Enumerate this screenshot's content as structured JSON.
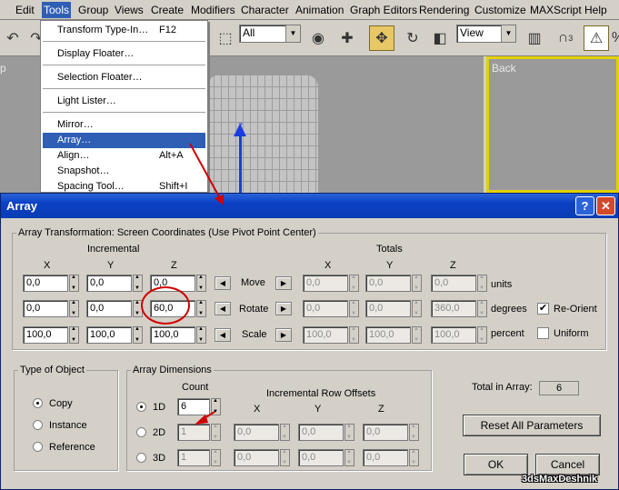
{
  "menubar": {
    "items": [
      "Edit",
      "Tools",
      "Group",
      "Views",
      "Create",
      "Modifiers",
      "Character",
      "Animation",
      "Graph Editors",
      "Rendering",
      "Customize",
      "MAXScript",
      "Help"
    ]
  },
  "toolbar": {
    "selection_filter": "All",
    "coord_system": "View",
    "snap_count": "3"
  },
  "viewports": {
    "right_label": "Back",
    "left_label": "p",
    "axis_label": "z"
  },
  "tools_menu": {
    "items": [
      {
        "label": "Transform Type-In…",
        "shortcut": "F12"
      },
      {
        "label": "Display Floater…",
        "shortcut": ""
      },
      {
        "label": "Selection Floater…",
        "shortcut": ""
      },
      {
        "label": "Light Lister…",
        "shortcut": ""
      },
      {
        "label": "Mirror…",
        "shortcut": ""
      },
      {
        "label": "Array…",
        "shortcut": ""
      },
      {
        "label": "Align…",
        "shortcut": "Alt+A"
      },
      {
        "label": "Snapshot…",
        "shortcut": ""
      },
      {
        "label": "Spacing Tool…",
        "shortcut": "Shift+I"
      }
    ]
  },
  "dialog": {
    "title": "Array",
    "help_btn": "?",
    "close_btn": "✕",
    "transform": {
      "legend": "Array Transformation: Screen Coordinates (Use Pivot Point Center)",
      "incremental": "Incremental",
      "totals": "Totals",
      "axes": [
        "X",
        "Y",
        "Z"
      ],
      "rows": [
        {
          "label": "Move",
          "unit": "units",
          "inc": [
            "0,0",
            "0,0",
            "0,0"
          ],
          "tot": [
            "0,0",
            "0,0",
            "0,0"
          ]
        },
        {
          "label": "Rotate",
          "unit": "degrees",
          "inc": [
            "0,0",
            "0,0",
            "60,0"
          ],
          "tot": [
            "0,0",
            "0,0",
            "360,0"
          ]
        },
        {
          "label": "Scale",
          "unit": "percent",
          "inc": [
            "100,0",
            "100,0",
            "100,0"
          ],
          "tot": [
            "100,0",
            "100,0",
            "100,0"
          ]
        }
      ],
      "reorient": "Re-Orient",
      "uniform": "Uniform"
    },
    "type_of_object": {
      "legend": "Type of Object",
      "options": [
        "Copy",
        "Instance",
        "Reference"
      ]
    },
    "dimensions": {
      "legend": "Array Dimensions",
      "count": "Count",
      "offsets": "Incremental Row Offsets",
      "axes": [
        "X",
        "Y",
        "Z"
      ],
      "rows": [
        {
          "label": "1D",
          "count": "6",
          "offsets": [
            "",
            "",
            ""
          ]
        },
        {
          "label": "2D",
          "count": "1",
          "offsets": [
            "0,0",
            "0,0",
            "0,0"
          ]
        },
        {
          "label": "3D",
          "count": "1",
          "offsets": [
            "0,0",
            "0,0",
            "0,0"
          ]
        }
      ]
    },
    "total_label": "Total in Array:",
    "total_value": "6",
    "reset": "Reset All Parameters",
    "ok": "OK",
    "cancel": "Cancel"
  },
  "watermark": "3dsMaxDeshnik",
  "colors": {
    "title_bar": "#0a40c4",
    "menu_highlight": "#2f5fb5",
    "annotation": "#d00000",
    "active_viewport": "#e2d100"
  }
}
